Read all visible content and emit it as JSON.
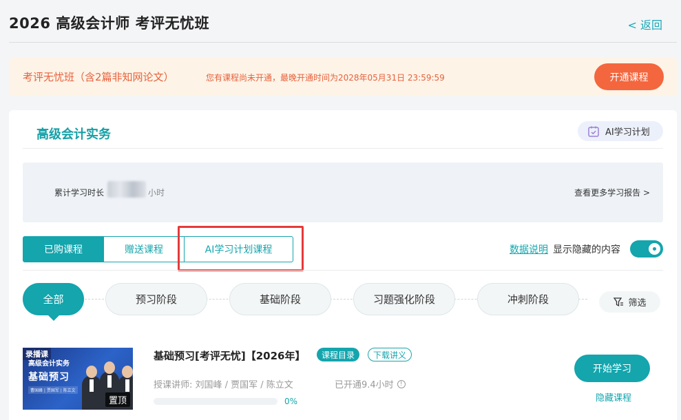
{
  "header": {
    "title": "2026 高级会计师 考评无忧班",
    "back_label": "< 返回"
  },
  "notice": {
    "class_name": "考评无忧班（含2篇非知网论文）",
    "message": "您有课程尚未开通，最晚开通时间为2028年05月31日 23:59:59",
    "open_button": "开通课程"
  },
  "subject": {
    "tab_label": "高级会计实务",
    "ai_plan_label": "AI学习计划"
  },
  "study_stats": {
    "label": "累计学习时长",
    "unit": "小时",
    "report_link": "查看更多学习报告 >"
  },
  "course_tabs": [
    "已购课程",
    "赠送课程",
    "AI学习计划课程"
  ],
  "options": {
    "data_link": "数据说明",
    "show_hidden_label": "显示隐藏的内容",
    "show_hidden_on": true
  },
  "stages": [
    "全部",
    "预习阶段",
    "基础阶段",
    "习题强化阶段",
    "冲刺阶段"
  ],
  "filter_label": "筛选",
  "course": {
    "thumb_tag": "录播课",
    "thumb_title1": "高级会计实务",
    "thumb_title2": "基础预习",
    "thumb_names": "曹国峰 | 贾国军 | 陈立文",
    "pin_label": "置顶",
    "title": "基础预习[考评无忧]【2026年】",
    "catalog_tag": "课程目录",
    "handout_tag": "下载讲义",
    "teachers": "授课讲师:   刘国峰 / 贾国军 / 陈立文",
    "opened": "已开通9.4小时",
    "progress": 0,
    "progress_text": "0%",
    "start_button": "开始学习",
    "hide_link": "隐藏课程"
  },
  "colors": {
    "accent": "#14a5ad",
    "warning": "#f4663e",
    "notice_bg": "#fdf4e7",
    "highlight": "#e5393a"
  }
}
